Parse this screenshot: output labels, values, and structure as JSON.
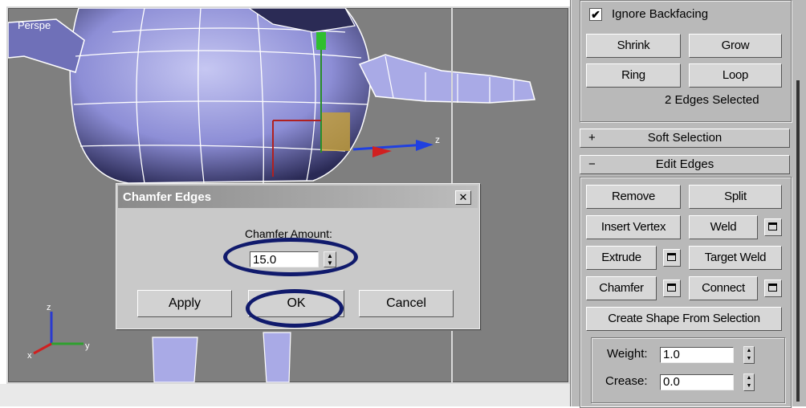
{
  "viewport": {
    "label": "Perspe"
  },
  "axes": {
    "z": "z",
    "x": "x",
    "y": "y"
  },
  "dialog": {
    "title": "Chamfer Edges",
    "close": "✕",
    "amount_label": "Chamfer Amount:",
    "amount_value": "15.0",
    "buttons": {
      "apply": "Apply",
      "ok": "OK",
      "cancel": "Cancel"
    }
  },
  "panel": {
    "ignore_backfacing": "Ignore Backfacing",
    "ignore_backfacing_checked": "✔",
    "shrink": "Shrink",
    "grow": "Grow",
    "ring": "Ring",
    "loop": "Loop",
    "selection_status": "2 Edges Selected",
    "soft_selection": {
      "sign": "+",
      "label": "Soft Selection"
    },
    "edit_edges": {
      "sign": "−",
      "label": "Edit Edges"
    },
    "remove": "Remove",
    "split": "Split",
    "insert_vertex": "Insert Vertex",
    "weld": "Weld",
    "extrude": "Extrude",
    "target_weld": "Target Weld",
    "chamfer": "Chamfer",
    "connect": "Connect",
    "create_shape": "Create Shape From Selection",
    "weight_label": "Weight:",
    "weight_value": "1.0",
    "crease_label": "Crease:",
    "crease_value": "0.0"
  },
  "colors": {
    "ink": "#101a6c",
    "model": "#8e8fd8",
    "viewport_bg": "#7f7f7f"
  }
}
